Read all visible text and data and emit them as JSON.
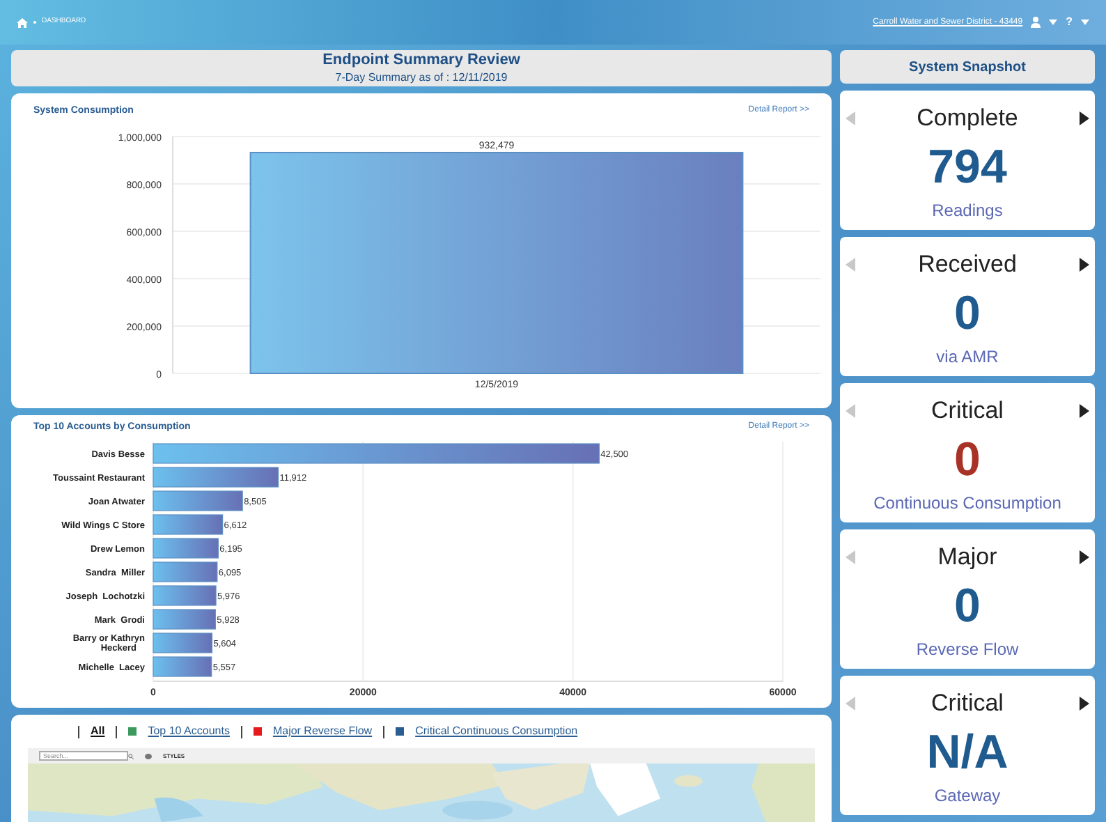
{
  "breadcrumb": {
    "label": "DASHBOARD"
  },
  "account": {
    "label": "Carroll Water and Sewer District - 43449",
    "help": "?"
  },
  "summary": {
    "title": "Endpoint Summary Review",
    "subtitle": "7-Day Summary as of : 12/11/2019"
  },
  "consumption": {
    "title": "System Consumption",
    "link": "Detail Report >>",
    "chart_data": {
      "type": "bar",
      "grid": true,
      "categories": [
        "12/5/2019"
      ],
      "values": [
        932479
      ],
      "ylim": [
        0,
        1000000
      ],
      "yticks": [
        {
          "value": 0,
          "label": "0"
        },
        {
          "value": 200000,
          "label": "200,000"
        },
        {
          "value": 400000,
          "label": "400,000"
        },
        {
          "value": 600000,
          "label": "600,000"
        },
        {
          "value": 800000,
          "label": "800,000"
        },
        {
          "value": 1000000,
          "label": "1,000,000"
        }
      ],
      "value_labels": [
        "932,479"
      ]
    }
  },
  "top_accounts": {
    "title": "Top 10 Accounts by Consumption",
    "link": "Detail Report >>",
    "chart_data": {
      "type": "bar",
      "orientation": "horizontal",
      "grid": true,
      "categories": [
        "Davis Besse",
        "Toussaint Restaurant",
        "Joan Atwater",
        "Wild Wings C Store",
        "Drew Lemon",
        "Sandra  Miller",
        "Joseph  Lochotzki",
        "Mark  Grodi",
        "Barry or Kathryn Heckerd",
        "Michelle  Lacey"
      ],
      "values": [
        42500,
        11912,
        8505,
        6612,
        6195,
        6095,
        5976,
        5928,
        5604,
        5557
      ],
      "xlim": [
        0,
        60000
      ],
      "xticks": [
        0,
        20000,
        40000,
        60000
      ],
      "value_labels": [
        "42,500",
        "11,912",
        "8,505",
        "6,612",
        "6,195",
        "6,095",
        "5,976",
        "5,928",
        "5,604",
        "5,557"
      ]
    }
  },
  "map": {
    "legend": [
      {
        "label": "All",
        "kind": "all",
        "selected": true
      },
      {
        "label": "Top 10 Accounts",
        "kind": "swatch",
        "color": "#3c9a5f",
        "selected": false
      },
      {
        "label": "Major Reverse Flow",
        "kind": "swatch",
        "color": "#e8191c",
        "selected": false
      },
      {
        "label": "Critical Continuous Consumption",
        "kind": "swatch",
        "color": "#2a5d92",
        "selected": false
      }
    ],
    "search": {
      "placeholder": "Search..."
    },
    "styles": "STYLES"
  },
  "snapshot": {
    "title": "System Snapshot",
    "cards": [
      {
        "title": "Complete",
        "value": "794",
        "caption": "Readings",
        "color": "#1f5b8e"
      },
      {
        "title": "Received",
        "value": "0",
        "caption": "via AMR",
        "color": "#1f5b8e"
      },
      {
        "title": "Critical",
        "value": "0",
        "caption": "Continuous Consumption",
        "color": "#a93226"
      },
      {
        "title": "Major",
        "value": "0",
        "caption": "Reverse Flow",
        "color": "#1f5b8e"
      },
      {
        "title": "Critical",
        "value": "N/A",
        "caption": "Gateway",
        "color": "#1f5b8e"
      }
    ]
  }
}
